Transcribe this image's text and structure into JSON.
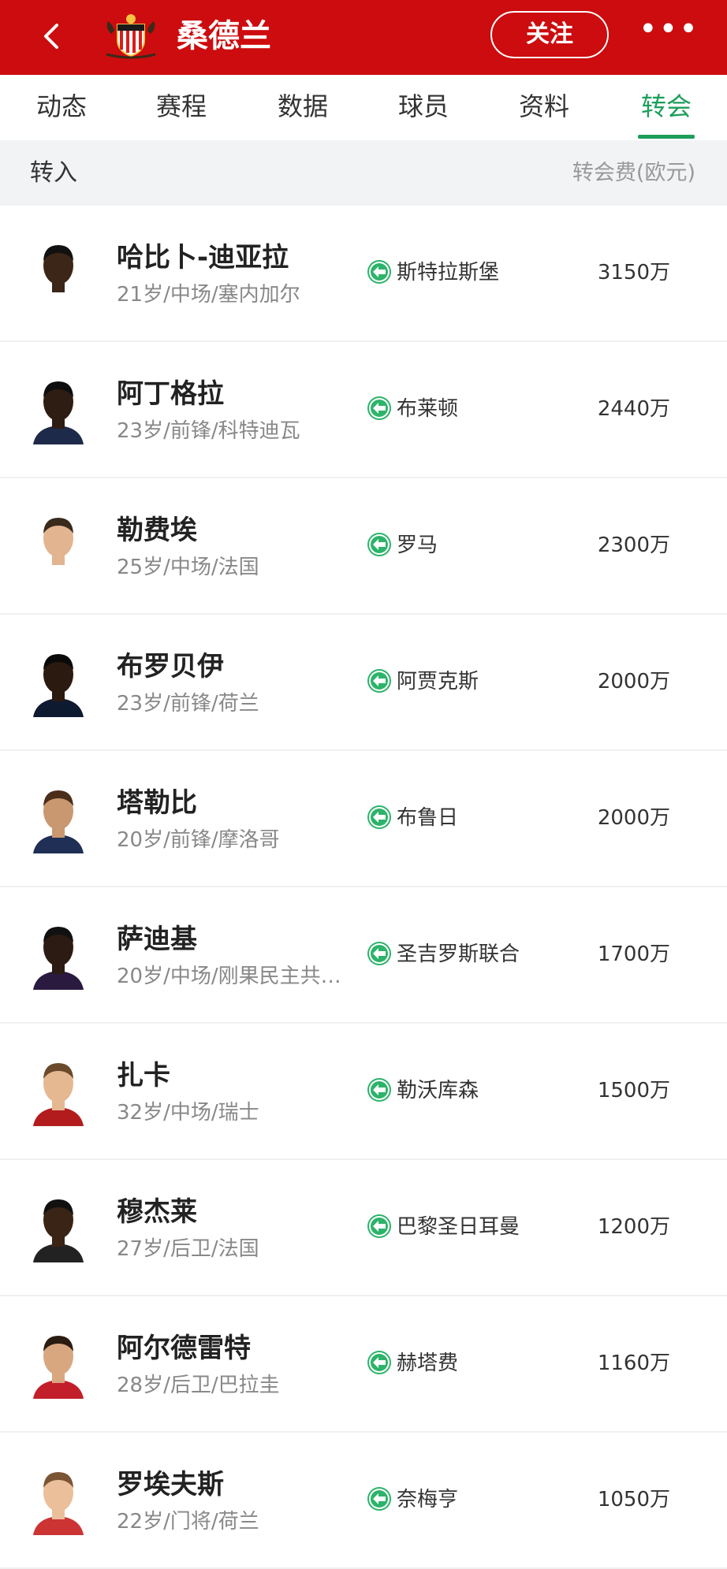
{
  "header": {
    "title": "桑德兰",
    "follow_label": "关注",
    "more_label": "•••",
    "bg_color": "#cc0c0e"
  },
  "tabs": [
    {
      "label": "动态"
    },
    {
      "label": "赛程"
    },
    {
      "label": "数据"
    },
    {
      "label": "球员"
    },
    {
      "label": "资料"
    },
    {
      "label": "转会",
      "active": true
    }
  ],
  "accent_color": "#1e9e5a",
  "subheader": {
    "left": "转入",
    "right": "转会费(欧元)"
  },
  "transfers": [
    {
      "name": "哈比卜-迪亚拉",
      "meta": "21岁/中场/塞内加尔",
      "club": "斯特拉斯堡",
      "fee": "3150万"
    },
    {
      "name": "阿丁格拉",
      "meta": "23岁/前锋/科特迪瓦",
      "club": "布莱顿",
      "fee": "2440万"
    },
    {
      "name": "勒费埃",
      "meta": "25岁/中场/法国",
      "club": "罗马",
      "fee": "2300万"
    },
    {
      "name": "布罗贝伊",
      "meta": "23岁/前锋/荷兰",
      "club": "阿贾克斯",
      "fee": "2000万"
    },
    {
      "name": "塔勒比",
      "meta": "20岁/前锋/摩洛哥",
      "club": "布鲁日",
      "fee": "2000万"
    },
    {
      "name": "萨迪基",
      "meta": "20岁/中场/刚果民主共…",
      "club": "圣吉罗斯联合",
      "fee": "1700万"
    },
    {
      "name": "扎卡",
      "meta": "32岁/中场/瑞士",
      "club": "勒沃库森",
      "fee": "1500万"
    },
    {
      "name": "穆杰莱",
      "meta": "27岁/后卫/法国",
      "club": "巴黎圣日耳曼",
      "fee": "1200万"
    },
    {
      "name": "阿尔德雷特",
      "meta": "28岁/后卫/巴拉圭",
      "club": "赫塔费",
      "fee": "1160万"
    },
    {
      "name": "罗埃夫斯",
      "meta": "22岁/门将/荷兰",
      "club": "奈梅亨",
      "fee": "1050万"
    }
  ]
}
